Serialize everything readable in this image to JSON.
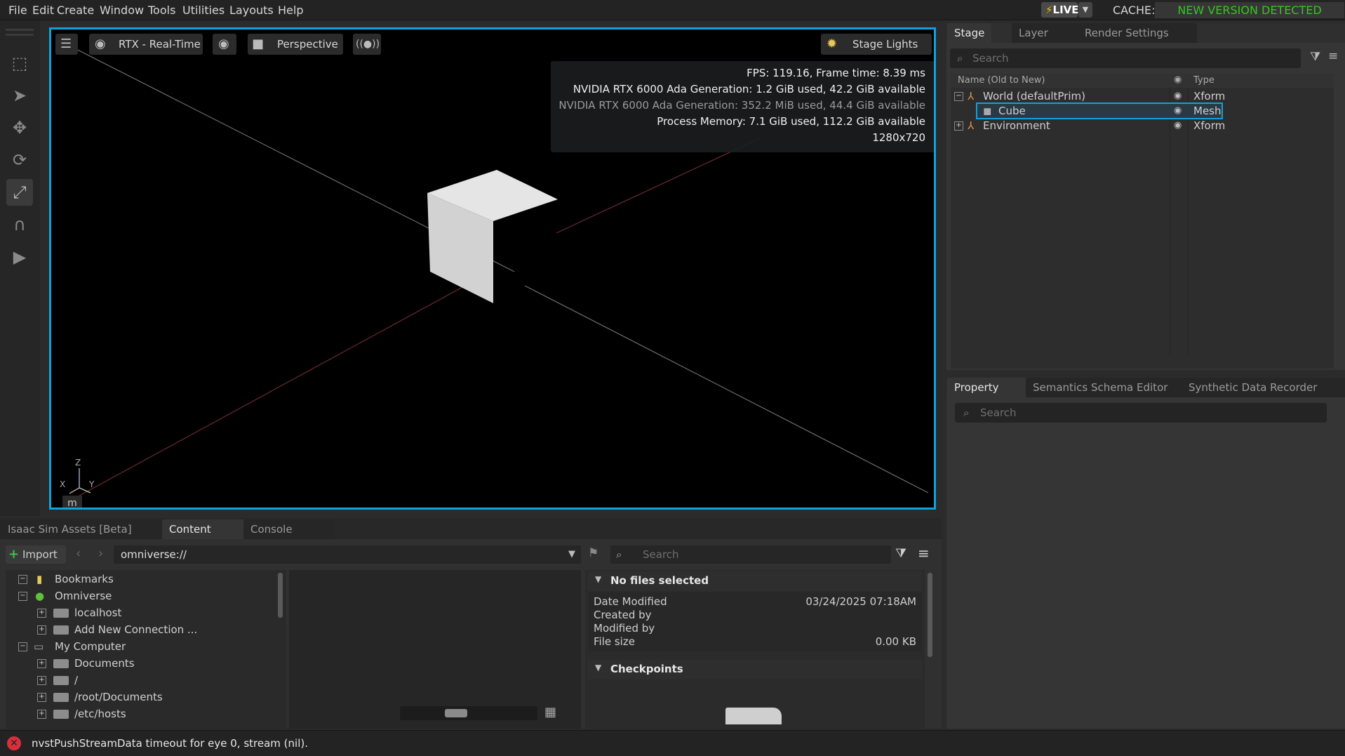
{
  "menubar": {
    "items": [
      "File",
      "Edit",
      "Create",
      "Window",
      "Tools",
      "Utilities",
      "Layouts",
      "Help"
    ],
    "live_label": "LIVE",
    "cache_label": "CACHE:",
    "new_version": "NEW VERSION DETECTED"
  },
  "viewport": {
    "renderer_label": "RTX - Real-Time",
    "camera_label": "Perspective",
    "stage_lights_label": "Stage Lights",
    "stats": {
      "fps": "FPS: 119.16, Frame time: 8.39 ms",
      "gpu1": "NVIDIA RTX 6000 Ada Generation: 1.2 GiB used, 42.2 GiB available",
      "gpu2": "NVIDIA RTX 6000 Ada Generation: 352.2 MiB used, 44.4 GiB available",
      "process": "Process Memory: 7.1 GiB used, 112.2 GiB available",
      "resolution": "1280x720"
    },
    "axis": {
      "z": "Z",
      "x": "X",
      "y": "Y",
      "unit": "m"
    }
  },
  "stage": {
    "tabs": [
      "Stage",
      "Layer",
      "Render Settings"
    ],
    "search_placeholder": "Search",
    "columns": {
      "name": "Name (Old to New)",
      "type": "Type"
    },
    "rows": [
      {
        "name": "World (defaultPrim)",
        "type": "Xform"
      },
      {
        "name": "Cube",
        "type": "Mesh"
      },
      {
        "name": "Environment",
        "type": "Xform"
      }
    ]
  },
  "property": {
    "tabs": [
      "Property",
      "Semantics Schema Editor",
      "Synthetic Data Recorder"
    ],
    "search_placeholder": "Search"
  },
  "content": {
    "tabs": [
      "Isaac Sim Assets [Beta]",
      "Content",
      "Console"
    ],
    "import_label": "Import",
    "path": "omniverse://",
    "search_placeholder": "Search",
    "tree": [
      "Bookmarks",
      "Omniverse",
      "localhost",
      "Add New Connection ...",
      "My Computer",
      "Documents",
      "/",
      "/root/Documents",
      "/etc/hosts"
    ],
    "details": {
      "header": "No files selected",
      "date_modified_label": "Date Modified",
      "date_modified_value": "03/24/2025 07:18AM",
      "created_by_label": "Created by",
      "modified_by_label": "Modified by",
      "file_size_label": "File size",
      "file_size_value": "0.00 KB",
      "checkpoints": "Checkpoints"
    }
  },
  "status": {
    "message": "nvstPushStreamData timeout for eye 0, stream (nil)."
  },
  "colors": {
    "viewport_border": "#0ea2dc",
    "selection": "#0ea2dc",
    "new_version": "#35c81b",
    "error": "#d8303a"
  }
}
